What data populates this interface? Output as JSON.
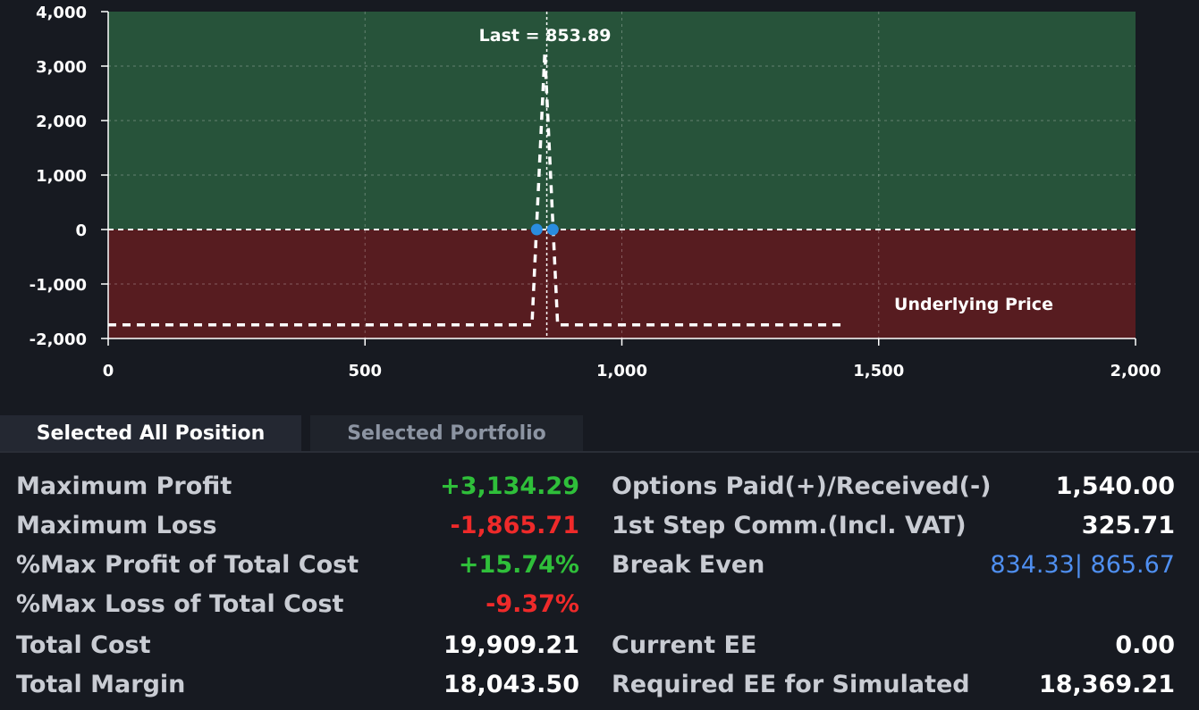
{
  "chart_data": {
    "type": "line",
    "xlabel": "Underlying Price",
    "ylabel": "",
    "xlim": [
      0,
      2000
    ],
    "ylim": [
      -2000,
      4000
    ],
    "x_ticks": [
      "0",
      "500",
      "1,000",
      "1,500",
      "2,000"
    ],
    "y_ticks": [
      "4,000",
      "3,000",
      "2,000",
      "1,000",
      "0",
      "-1,000",
      "-2,000"
    ],
    "series": [
      {
        "x": [
          0,
          825,
          850,
          875,
          1430
        ],
        "y": [
          -1865.71,
          -1865.71,
          3134.29,
          -1865.71,
          -1865.71
        ]
      }
    ],
    "last_price": 853.89,
    "last_label": "Last = 853.89",
    "break_even_points": [
      834.33,
      865.67
    ],
    "profit_zone_color": "#27533a",
    "loss_zone_color": "#571c20",
    "marker_color": "#2a8ddf",
    "grid": true
  },
  "tabs": {
    "selected_all_position": "Selected All Position",
    "selected_portfolio": "Selected Portfolio"
  },
  "stats_left": {
    "max_profit_label": "Maximum Profit",
    "max_profit_value": "+3,134.29",
    "max_loss_label": "Maximum Loss",
    "max_loss_value": "-1,865.71",
    "pct_max_profit_label": "%Max Profit of Total Cost",
    "pct_max_profit_value": "+15.74%",
    "pct_max_loss_label": "%Max Loss of Total Cost",
    "pct_max_loss_value": "-9.37%",
    "total_cost_label": "Total Cost",
    "total_cost_value": "19,909.21",
    "total_margin_label": "Total Margin",
    "total_margin_value": "18,043.50"
  },
  "stats_right": {
    "options_paid_label": "Options Paid(+)/Received(-)",
    "options_paid_value": "1,540.00",
    "first_step_comm_label": "1st Step Comm.(Incl. VAT)",
    "first_step_comm_value": "325.71",
    "break_even_label": "Break Even",
    "break_even_value": "834.33| 865.67",
    "current_ee_label": "Current EE",
    "current_ee_value": "0.00",
    "required_ee_label": "Required EE for Simulated",
    "required_ee_value": "18,369.21"
  }
}
